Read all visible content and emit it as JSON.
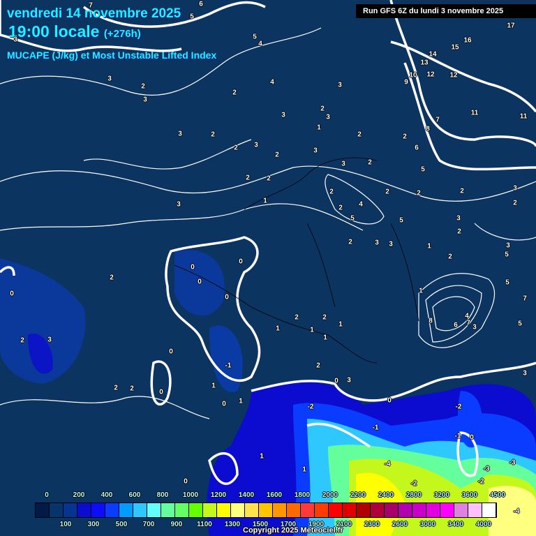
{
  "header": {
    "date": "vendredi 14 novembre 2025",
    "time": "19:00 locale",
    "lead": "(+276h)",
    "parameter": "MUCAPE (J/kg) et Most Unstable Lifted Index",
    "run": "Run GFS 6Z du lundi 3 novembre 2025"
  },
  "legend": {
    "top_labels": [
      "0",
      "200",
      "400",
      "600",
      "800",
      "1000",
      "1200",
      "1400",
      "1600",
      "1800",
      "2000",
      "2200",
      "2400",
      "2800",
      "3200",
      "3600",
      "4500"
    ],
    "bottom_labels": [
      "100",
      "300",
      "500",
      "700",
      "900",
      "1100",
      "1300",
      "1500",
      "1700",
      "1900",
      "2100",
      "2300",
      "2600",
      "3000",
      "3400",
      "4000"
    ],
    "colors": [
      "#021a45",
      "#05356a",
      "#063591",
      "#0b0ccf",
      "#0c0cff",
      "#0a3cff",
      "#009cff",
      "#2ec8ff",
      "#63ffff",
      "#64ff9c",
      "#64ff64",
      "#66ff00",
      "#c4f81c",
      "#ffff00",
      "#ffff80",
      "#ffe14c",
      "#ffc600",
      "#ff9800",
      "#ff6a00",
      "#ff3838",
      "#ff3c00",
      "#ff0000",
      "#e00000",
      "#b00000",
      "#b0003c",
      "#a8006a",
      "#b000b0",
      "#c800c8",
      "#e000e0",
      "#ff00ff",
      "#e080e0",
      "#ffc0ff",
      "#ffffff"
    ]
  },
  "lifted_index_labels": [
    "7",
    "5",
    "6",
    "5",
    "4",
    "3",
    "3",
    "2",
    "3",
    "4",
    "3",
    "2",
    "3",
    "2",
    "3",
    "3",
    "2",
    "1",
    "3",
    "2",
    "2",
    "3",
    "3",
    "2",
    "2",
    "2",
    "2",
    "2",
    "1",
    "3",
    "2",
    "2",
    "2",
    "2",
    "5",
    "4",
    "5",
    "3",
    "3",
    "2",
    "1",
    "2",
    "3",
    "2",
    "3",
    "2",
    "2",
    "3",
    "2",
    "1",
    "0",
    "0",
    "0",
    "0",
    "0",
    "2",
    "1",
    "2",
    "1",
    "1",
    "0",
    "-1",
    "1",
    "0",
    "0",
    "2",
    "2",
    "1",
    "0",
    "-2",
    "-1",
    "0",
    "1",
    "1",
    "1",
    "0",
    "8",
    "7",
    "6",
    "5",
    "4",
    "3",
    "5",
    "7",
    "5",
    "3",
    "2",
    "3",
    "2",
    "3",
    "-2",
    "-1",
    "0",
    "-4",
    "-2",
    "-3",
    "-4",
    "-3",
    "-2",
    "14",
    "16",
    "15",
    "13",
    "12",
    "12",
    "11",
    "11",
    "10",
    "9",
    "8",
    "7",
    "6",
    "5",
    "17"
  ],
  "copyright": "Copyright 2025 Meteociel.fr"
}
